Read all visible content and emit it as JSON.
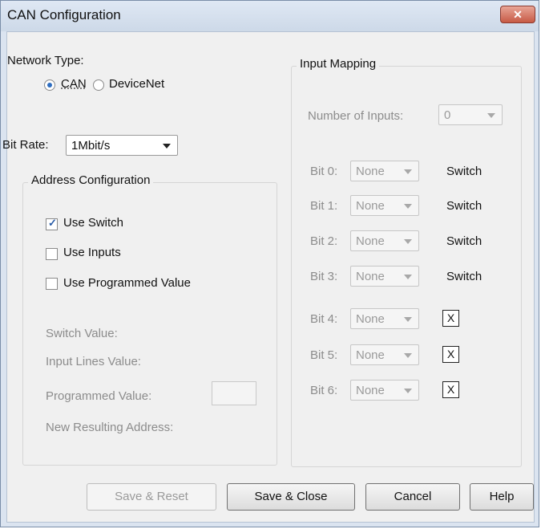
{
  "window": {
    "title": "CAN Configuration",
    "close_label": "✕"
  },
  "network": {
    "label": "Network Type:",
    "options": [
      {
        "label": "CAN",
        "selected": true
      },
      {
        "label": "DeviceNet",
        "selected": false
      }
    ]
  },
  "bit_rate": {
    "label": "Bit Rate:",
    "value": "1Mbit/s"
  },
  "address": {
    "legend": "Address Configuration",
    "checkboxes": [
      {
        "label": "Use Switch",
        "checked": true
      },
      {
        "label": "Use Inputs",
        "checked": false
      },
      {
        "label": "Use Programmed Value",
        "checked": false
      }
    ],
    "switch_value_label": "Switch Value:",
    "input_lines_label": "Input Lines Value:",
    "programmed_value_label": "Programmed Value:",
    "new_address_label": "New Resulting Address:"
  },
  "input_mapping": {
    "legend": "Input Mapping",
    "number_label": "Number of Inputs:",
    "number_value": "0",
    "bits": [
      {
        "label": "Bit 0:",
        "value": "None",
        "status": "Switch"
      },
      {
        "label": "Bit 1:",
        "value": "None",
        "status": "Switch"
      },
      {
        "label": "Bit 2:",
        "value": "None",
        "status": "Switch"
      },
      {
        "label": "Bit 3:",
        "value": "None",
        "status": "Switch"
      },
      {
        "label": "Bit 4:",
        "value": "None",
        "status": "X"
      },
      {
        "label": "Bit 5:",
        "value": "None",
        "status": "X"
      },
      {
        "label": "Bit 6:",
        "value": "None",
        "status": "X"
      }
    ]
  },
  "buttons": {
    "save_reset": "Save & Reset",
    "save_close": "Save & Close",
    "cancel": "Cancel",
    "help": "Help"
  },
  "colors": {
    "accent": "#2f6ec0",
    "close_button": "#c75a45",
    "disabled_text": "#8c8c8c"
  }
}
